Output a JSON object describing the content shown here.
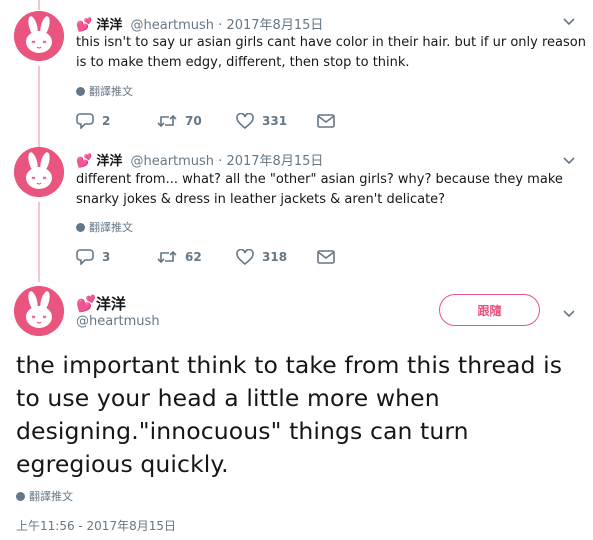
{
  "colors": {
    "accent": "#e9557f",
    "thread_line": "#f4c6d3",
    "secondary_text": "#657786"
  },
  "tweets": [
    {
      "name": "洋洋",
      "handle": "@heartmush",
      "date": "2017年8月15日",
      "text": "this isn't to say ur asian girls cant have color in their hair. but if ur only reason is to make them edgy, different, then stop to think.",
      "translate": "翻譯推文",
      "replies": "2",
      "retweets": "70",
      "likes": "331"
    },
    {
      "name": "洋洋",
      "handle": "@heartmush",
      "date": "2017年8月15日",
      "text": "different from... what? all the \"other\" asian girls? why? because they make snarky jokes & dress in leather jackets & aren't delicate?",
      "translate": "翻譯推文",
      "replies": "3",
      "retweets": "62",
      "likes": "318"
    }
  ],
  "main_tweet": {
    "name": "洋洋",
    "handle": "@heartmush",
    "follow_label": "跟隨",
    "text": "the important think to take from this thread is to use your head a little more when designing.\"innocuous\" things can turn egregious quickly.",
    "translate": "翻譯推文",
    "timestamp": "上午11:56 - 2017年8月15日"
  },
  "icons": [
    "avatar-bunny",
    "heart-emoji",
    "chevron-down-icon",
    "globe-icon",
    "reply-icon",
    "retweet-icon",
    "like-icon",
    "dm-icon"
  ]
}
